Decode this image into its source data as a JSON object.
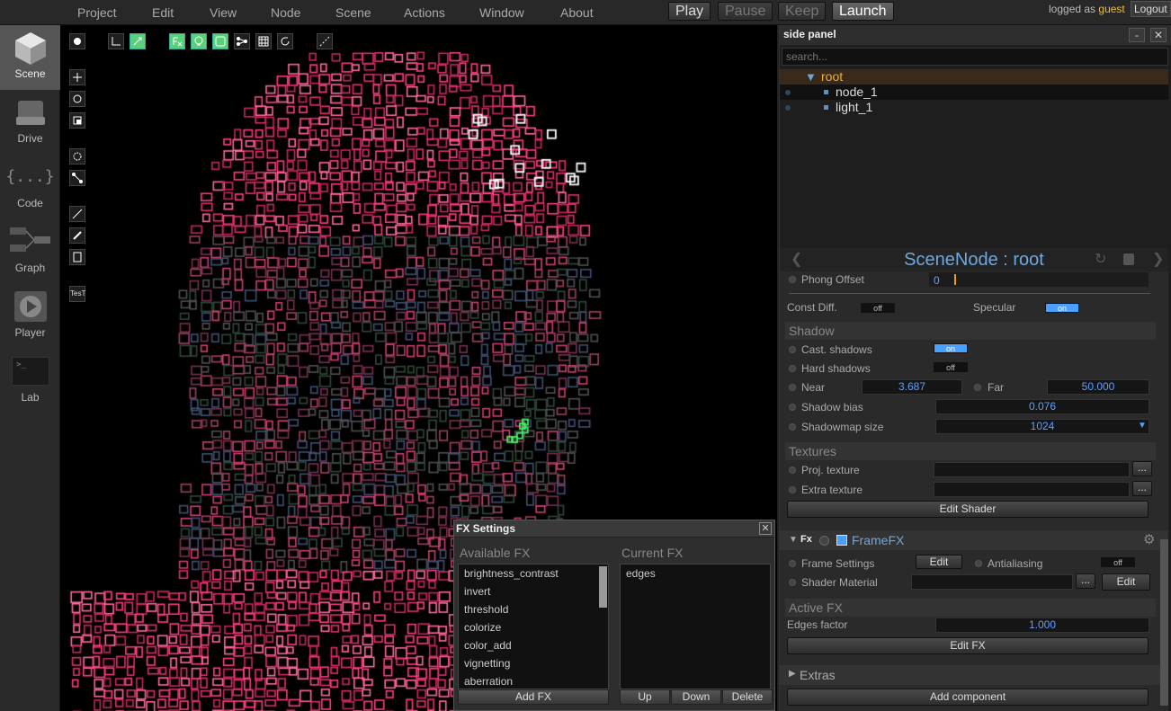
{
  "menu": [
    "Project",
    "Edit",
    "View",
    "Node",
    "Scene",
    "Actions",
    "Window",
    "About"
  ],
  "toolbar": {
    "play": "Play",
    "pause": "Pause",
    "keep": "Keep",
    "launch": "Launch"
  },
  "login": {
    "prefix": "logged as",
    "user": "guest",
    "logout": "Logout"
  },
  "nav": [
    {
      "label": "Scene",
      "icon": "cube-icon"
    },
    {
      "label": "Drive",
      "icon": "drive-icon"
    },
    {
      "label": "Code",
      "icon": "braces-icon",
      "glyph": "{...}"
    },
    {
      "label": "Graph",
      "icon": "graph-icon"
    },
    {
      "label": "Player",
      "icon": "play-icon"
    },
    {
      "label": "Lab",
      "icon": "terminal-icon",
      "glyph": ">_"
    }
  ],
  "viewport_tools": {
    "test_label": "TesT"
  },
  "fx_settings": {
    "title": "FX Settings",
    "available_title": "Available FX",
    "current_title": "Current FX",
    "available": [
      "brightness_contrast",
      "invert",
      "threshold",
      "colorize",
      "color_add",
      "vignetting",
      "aberration"
    ],
    "current": [
      "edges"
    ],
    "add_btn": "Add FX",
    "up_btn": "Up",
    "down_btn": "Down",
    "delete_btn": "Delete"
  },
  "side_panel": {
    "title": "side panel",
    "min_btn": "-",
    "close_btn": "✕",
    "search_placeholder": "search...",
    "tree": {
      "root": "root",
      "children": [
        "node_1",
        "light_1"
      ]
    }
  },
  "inspector": {
    "title": "SceneNode : root",
    "phong_offset_label": "Phong Offset",
    "phong_offset_value": "0",
    "const_diff_label": "Const Diff.",
    "const_diff_value": "off",
    "specular_label": "Specular",
    "specular_value": "on",
    "shadow_section": "Shadow",
    "cast_shadows_label": "Cast. shadows",
    "cast_shadows_value": "on",
    "hard_shadows_label": "Hard shadows",
    "hard_shadows_value": "off",
    "near_label": "Near",
    "near_value": "3.687",
    "far_label": "Far",
    "far_value": "50.000",
    "shadow_bias_label": "Shadow bias",
    "shadow_bias_value": "0.076",
    "shadowmap_label": "Shadowmap size",
    "shadowmap_value": "1024",
    "textures_section": "Textures",
    "proj_texture_label": "Proj. texture",
    "extra_texture_label": "Extra texture",
    "browse_btn": "...",
    "edit_shader_btn": "Edit Shader",
    "framefx_title": "FrameFX",
    "frame_settings_label": "Frame Settings",
    "frame_settings_btn": "Edit",
    "antialiasing_label": "Antialiasing",
    "antialiasing_value": "off",
    "shader_material_label": "Shader Material",
    "shader_material_btn": "Edit",
    "active_fx_section": "Active FX",
    "edges_factor_label": "Edges factor",
    "edges_factor_value": "1.000",
    "edit_fx_btn": "Edit FX",
    "extras_title": "Extras",
    "add_component_btn": "Add component"
  }
}
